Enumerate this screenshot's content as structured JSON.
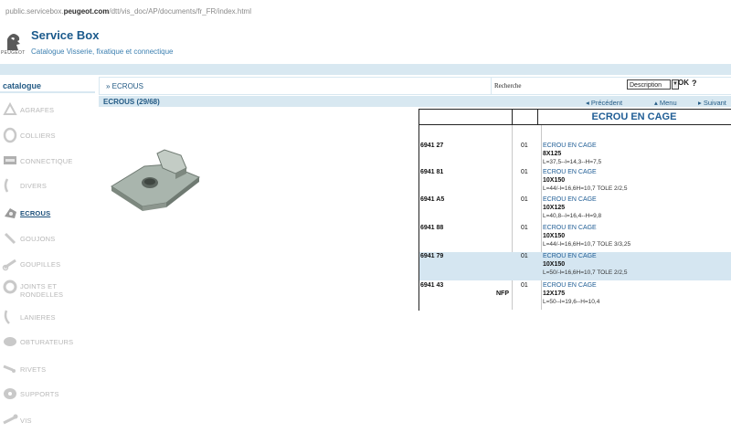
{
  "browser": {
    "url_prefix": "public.servicebox.",
    "url_domain": "peugeot.com",
    "url_path": "/dtt/vis_doc/AP/documents/fr_FR/index.html"
  },
  "brand": {
    "logo_text": "PEUGEOT",
    "title": "Service Box",
    "subtitle": "Catalogue Visserie, fixatique et connectique"
  },
  "sidebar": {
    "title": "catalogue",
    "items": [
      {
        "label": "AGRAFES"
      },
      {
        "label": "COLLIERS"
      },
      {
        "label": "CONNECTIQUE"
      },
      {
        "label": "DIVERS"
      },
      {
        "label": "ECROUS"
      },
      {
        "label": "GOUJONS"
      },
      {
        "label": "GOUPILLES"
      },
      {
        "label": "JOINTS ET"
      },
      {
        "label": "LANIERES"
      },
      {
        "label": "OBTURATEURS"
      },
      {
        "label": "RIVETS"
      },
      {
        "label": "SUPPORTS"
      },
      {
        "label": "VIS"
      }
    ],
    "joints_line2": "RONDELLES"
  },
  "breadcrumb": "» ECROUS",
  "search": {
    "label": "Recherche",
    "value": "",
    "select_value": "Description",
    "ok": "OK",
    "help": "?"
  },
  "section": {
    "title": "ECROUS (29/68)",
    "prev": "◂  Précédent",
    "menu": "▴  Menu",
    "next": "▸  Suivant"
  },
  "table": {
    "header_title": "ECROU EN CAGE",
    "rows": [
      {
        "ref": "6941 27",
        "nfp": "",
        "qty": "01",
        "name": "ECROU EN CAGE",
        "size": "8X125",
        "dims": "L=37,5--l=14,3--H=7,5",
        "highlight": false
      },
      {
        "ref": "6941 81",
        "nfp": "",
        "qty": "01",
        "name": "ECROU EN CAGE",
        "size": "10X150",
        "dims": "L=44/-l=16,6H=10,7 TOLE 2/2,5",
        "highlight": false
      },
      {
        "ref": "6941 A5",
        "nfp": "",
        "qty": "01",
        "name": "ECROU EN CAGE",
        "size": "10X125",
        "dims": "L=40,8--l=16,4--H=9,8",
        "highlight": false
      },
      {
        "ref": "6941 88",
        "nfp": "",
        "qty": "01",
        "name": "ECROU EN CAGE",
        "size": "10X150",
        "dims": "L=44/-l=16,6H=10,7 TOLE 3/3,25",
        "highlight": false
      },
      {
        "ref": "6941 79",
        "nfp": "",
        "qty": "01",
        "name": "ECROU EN CAGE",
        "size": "10X150",
        "dims": "L=50/-l=16,6H=10,7 TOLE 2/2,5",
        "highlight": true
      },
      {
        "ref": "6941 43",
        "nfp": "NFP",
        "qty": "01",
        "name": "ECROU EN CAGE",
        "size": "12X175",
        "dims": "L=50--l=19,6--H=10,4",
        "highlight": false
      }
    ]
  },
  "colors": {
    "accent": "#1b5a8c",
    "band": "#d8e8f1",
    "row_highlight": "#d5e6f1"
  }
}
